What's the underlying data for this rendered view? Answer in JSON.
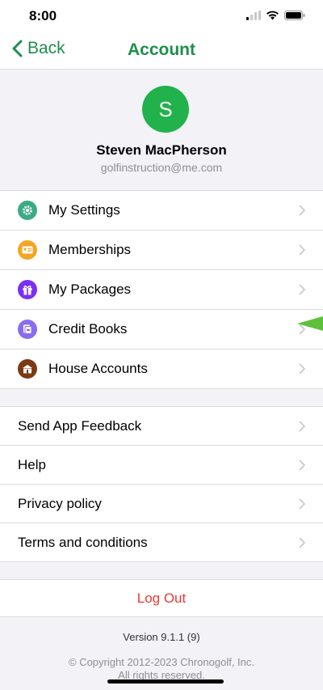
{
  "status_bar": {
    "time": "8:00"
  },
  "nav": {
    "back_label": "Back",
    "title": "Account"
  },
  "profile": {
    "initial": "S",
    "name": "Steven MacPherson",
    "email": "golfinstruction@me.com"
  },
  "menu_primary": [
    {
      "label": "My Settings",
      "icon": "gear-icon",
      "color": "#3bab85"
    },
    {
      "label": "Memberships",
      "icon": "membership-card-icon",
      "color": "#f2a623"
    },
    {
      "label": "My Packages",
      "icon": "gift-icon",
      "color": "#7b2ff2"
    },
    {
      "label": "Credit Books",
      "icon": "credit-book-icon",
      "color": "#8a6cf0"
    },
    {
      "label": "House Accounts",
      "icon": "house-account-icon",
      "color": "#7b3a12"
    }
  ],
  "menu_secondary": [
    {
      "label": "Send App Feedback"
    },
    {
      "label": "Help"
    },
    {
      "label": "Privacy policy"
    },
    {
      "label": "Terms and conditions"
    }
  ],
  "logout": {
    "label": "Log Out"
  },
  "footer": {
    "version": "Version 9.1.1 (9)",
    "copyright_line1": "© Copyright 2012-2023 Chronogolf, Inc.",
    "copyright_line2": "All rights reserved."
  },
  "colors": {
    "accent": "#1e8e4a",
    "avatar": "#21b24b",
    "danger": "#e53935",
    "pointer": "#5cc03b"
  }
}
